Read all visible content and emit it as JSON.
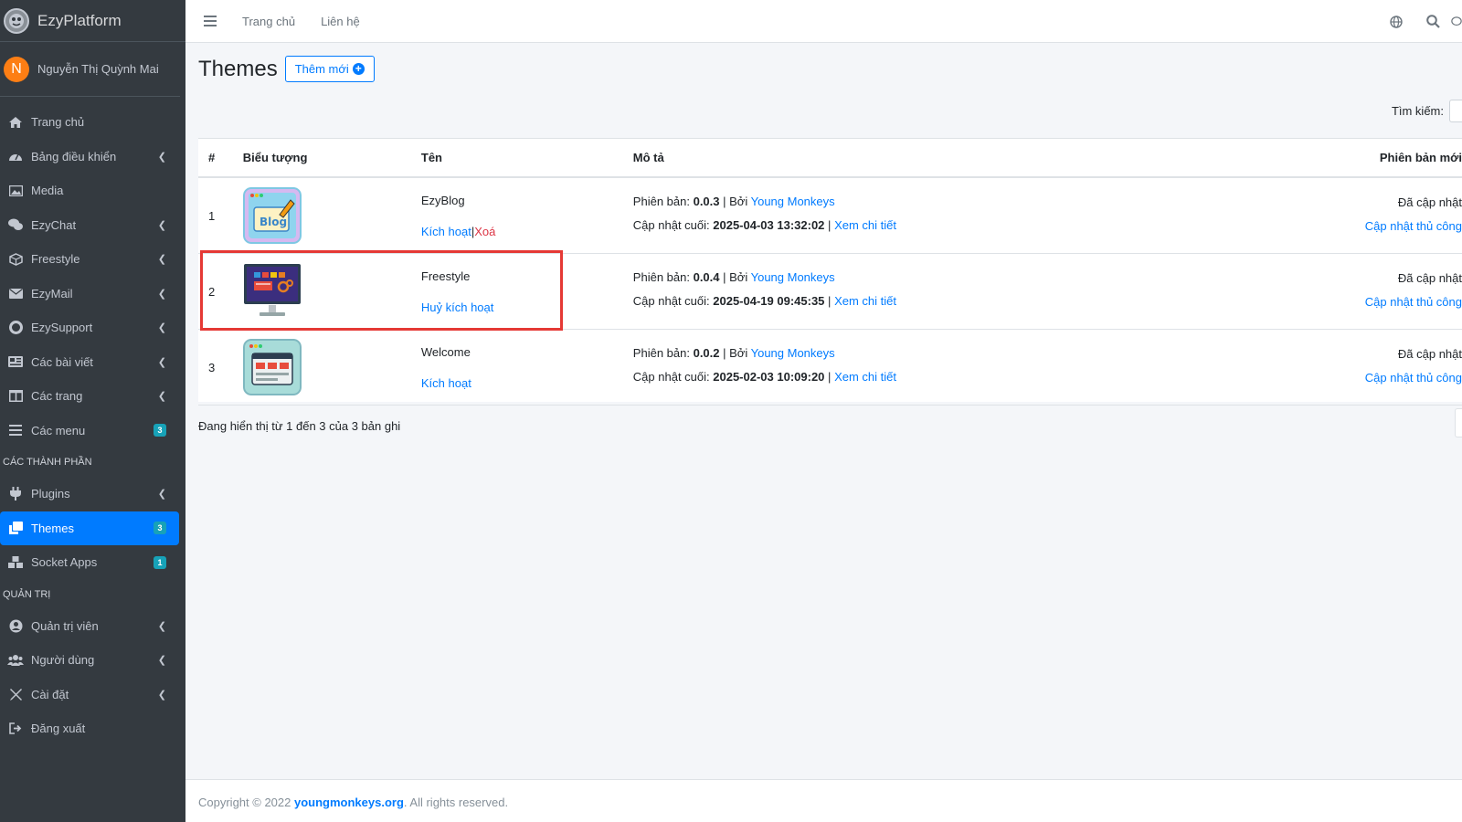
{
  "brand": {
    "name": "EzyPlatform"
  },
  "user": {
    "initial": "N",
    "name": "Nguyễn Thị Quỳnh Mai"
  },
  "sidebar": {
    "items": [
      {
        "label": "Trang chủ"
      },
      {
        "label": "Bảng điều khiển"
      },
      {
        "label": "Media"
      },
      {
        "label": "EzyChat"
      },
      {
        "label": "Freestyle"
      },
      {
        "label": "EzyMail"
      },
      {
        "label": "EzySupport"
      },
      {
        "label": "Các bài viết"
      },
      {
        "label": "Các trang"
      },
      {
        "label": "Các menu",
        "badge": "3"
      }
    ],
    "header_components": "CÁC THÀNH PHẦN",
    "components": [
      {
        "label": "Plugins"
      },
      {
        "label": "Themes",
        "badge": "3"
      },
      {
        "label": "Socket Apps",
        "badge": "1"
      }
    ],
    "header_admin": "QUẢN TRỊ",
    "admin": [
      {
        "label": "Quản trị viên"
      },
      {
        "label": "Người dùng"
      },
      {
        "label": "Cài đặt"
      },
      {
        "label": "Đăng xuất"
      }
    ]
  },
  "topbar": {
    "home": "Trang chủ",
    "contact": "Liên hệ"
  },
  "page": {
    "title": "Themes",
    "add_label": "Thêm mới",
    "search_label": "Tìm kiếm:"
  },
  "table": {
    "headers": {
      "num": "#",
      "icon": "Biểu tượng",
      "name": "Tên",
      "desc": "Mô tả",
      "update": "Phiên bản mới"
    },
    "rows": [
      {
        "num": "1",
        "name": "EzyBlog",
        "action1": "Kích hoạt",
        "sep": "|",
        "action2": "Xoá",
        "version_label": "Phiên bản:",
        "version": "0.0.3",
        "by": "| Bởi",
        "author": "Young Monkeys",
        "updated_label": "Cập nhật cuối:",
        "updated": "2025-04-03 13:32:02",
        "sep2": "|",
        "detail": "Xem chi tiết",
        "status": "Đã cập nhật",
        "update_link": "Cập nhật thủ công"
      },
      {
        "num": "2",
        "name": "Freestyle",
        "action1": "Huỷ kích hoạt",
        "version_label": "Phiên bản:",
        "version": "0.0.4",
        "by": "| Bởi",
        "author": "Young Monkeys",
        "updated_label": "Cập nhật cuối:",
        "updated": "2025-04-19 09:45:35",
        "sep2": "|",
        "detail": "Xem chi tiết",
        "status": "Đã cập nhật",
        "update_link": "Cập nhật thủ công"
      },
      {
        "num": "3",
        "name": "Welcome",
        "action1": "Kích hoạt",
        "version_label": "Phiên bản:",
        "version": "0.0.2",
        "by": "| Bởi",
        "author": "Young Monkeys",
        "updated_label": "Cập nhật cuối:",
        "updated": "2025-02-03 10:09:20",
        "sep2": "|",
        "detail": "Xem chi tiết",
        "status": "Đã cập nhật",
        "update_link": "Cập nhật thủ công"
      }
    ]
  },
  "info": "Đang hiển thị từ 1 đến 3 của 3 bản ghi",
  "footer": {
    "prefix": "Copyright © 2022",
    "link": "youngmonkeys.org",
    "suffix": ". All rights reserved."
  },
  "colors": {
    "sidebar_bg": "#343a40",
    "accent": "#007bff",
    "danger": "#dc3545",
    "highlight": "#e53935"
  }
}
